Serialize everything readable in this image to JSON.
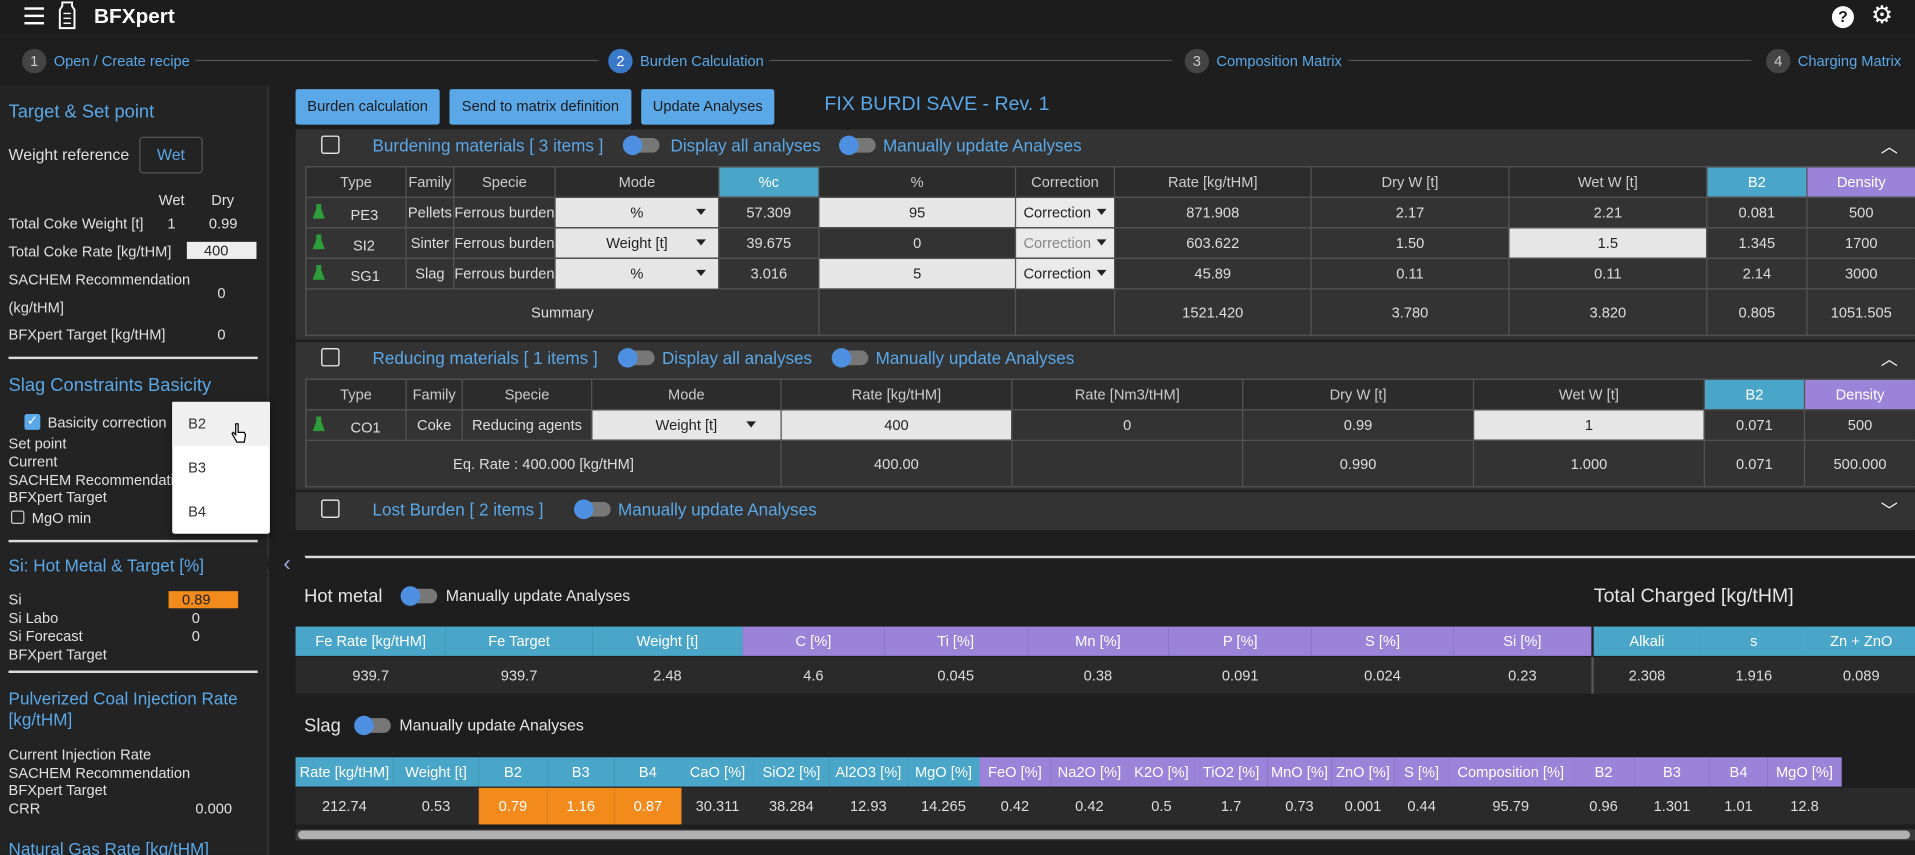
{
  "app": {
    "title": "BFXpert"
  },
  "steps": [
    {
      "num": "1",
      "label": "Open / Create recipe"
    },
    {
      "num": "2",
      "label": "Burden Calculation"
    },
    {
      "num": "3",
      "label": "Composition Matrix"
    },
    {
      "num": "4",
      "label": "Charging Matrix"
    }
  ],
  "sidebar": {
    "target_title": "Target & Set point",
    "weight_ref_label": "Weight reference",
    "weight_ref_value": "Wet",
    "col_wet": "Wet",
    "col_dry": "Dry",
    "total_coke_weight_label": "Total Coke Weight [t]",
    "total_coke_weight_wet": "1",
    "total_coke_weight_dry": "0.99",
    "total_coke_rate_label": "Total Coke Rate [kg/tHM]",
    "total_coke_rate_value": "400",
    "sachem_label_1": "SACHEM Recommendation",
    "sachem_label_2": "(kg/tHM]",
    "sachem_value": "0",
    "bfx_target_label": "BFXpert Target [kg/tHM]",
    "bfx_target_value": "0",
    "slag_title": "Slag Constraints Basicity",
    "basicity_label": "Basicity correction",
    "set_point": "Set point",
    "current": "Current",
    "sachem_rec": "SACHEM Recommendation",
    "bfx_target": "BFXpert Target",
    "mgo_min": "MgO min",
    "si_title": "Si: Hot Metal & Target [%]",
    "si_label": "Si",
    "si_value": "0.89",
    "si_labo_label": "Si Labo",
    "si_labo_value": "0",
    "si_forecast_label": "Si Forecast",
    "si_forecast_value": "0",
    "si_bfx_target": "BFXpert Target",
    "pci_title_1": "Pulverized Coal Injection Rate",
    "pci_title_2": "[kg/tHM]",
    "pci_current": "Current Injection Rate",
    "pci_sachem": "SACHEM Recommendation",
    "pci_bfx": "BFXpert Target",
    "crr_label": "CRR",
    "crr_value": "0.000",
    "ng_title": "Natural Gas Rate [kg/tHM]"
  },
  "dropdown": {
    "options": [
      "B2",
      "B3",
      "B4"
    ]
  },
  "toolbar": {
    "burden_calc": "Burden calculation",
    "send_matrix": "Send to matrix definition",
    "update_analyses": "Update Analyses",
    "recipe_name": "FIX BURDI SAVE - Rev. 1"
  },
  "burdening": {
    "title": "Burdening materials [ 3 items ]",
    "toggle1": "Display all analyses",
    "toggle2": "Manually update Analyses",
    "headers": [
      "Type",
      "Family",
      "Specie",
      "Mode",
      "%c",
      "%",
      "Correction",
      "Rate [kg/tHM]",
      "Dry W [t]",
      "Wet W [t]",
      "B2",
      "Density"
    ],
    "rows": [
      {
        "code": "PE3",
        "family": "Pellets",
        "specie": "Ferrous burden",
        "mode": "%",
        "pc": "57.309",
        "p": "95",
        "corr": "Correction",
        "rate": "871.908",
        "dry": "2.17",
        "wet": "2.21",
        "b2": "0.081",
        "density": "500"
      },
      {
        "code": "SI2",
        "family": "Sinter",
        "specie": "Ferrous burden",
        "mode": "Weight [t]",
        "pc": "39.675",
        "p": "0",
        "corr": "Correction",
        "rate": "603.622",
        "dry": "1.50",
        "wet": "1.5",
        "b2": "1.345",
        "density": "1700"
      },
      {
        "code": "SG1",
        "family": "Slag",
        "specie": "Ferrous burden",
        "mode": "%",
        "pc": "3.016",
        "p": "5",
        "corr": "Correction",
        "rate": "45.89",
        "dry": "0.11",
        "wet": "0.11",
        "b2": "2.14",
        "density": "3000"
      }
    ],
    "summary": {
      "label": "Summary",
      "rate": "1521.420",
      "dry": "3.780",
      "wet": "3.820",
      "b2": "0.805",
      "density": "1051.505"
    }
  },
  "reducing": {
    "title": "Reducing materials [ 1 items ]",
    "toggle1": "Display all analyses",
    "toggle2": "Manually update Analyses",
    "headers": [
      "Type",
      "Family",
      "Specie",
      "Mode",
      "Rate [kg/tHM]",
      "Rate [Nm3/tHM]",
      "Dry W [t]",
      "Wet W [t]",
      "B2",
      "Density"
    ],
    "row": {
      "code": "CO1",
      "family": "Coke",
      "specie": "Reducing agents",
      "mode": "Weight [t]",
      "rate": "400",
      "rate_nm3": "0",
      "dry": "0.99",
      "wet": "1",
      "b2": "0.071",
      "density": "500"
    },
    "eq": {
      "label": "Eq. Rate : 400.000 [kg/tHM]",
      "rate": "400.00",
      "dry": "0.990",
      "wet": "1.000",
      "b2": "0.071",
      "density": "500.000"
    }
  },
  "lost": {
    "title": "Lost Burden [ 2 items ]",
    "toggle": "Manually update Analyses"
  },
  "hot_metal": {
    "title": "Hot metal",
    "toggle": "Manually update Analyses",
    "total_charged": "Total Charged [kg/tHM]",
    "headers": [
      "Fe Rate [kg/tHM]",
      "Fe Target",
      "Weight [t]",
      "C [%]",
      "Ti [%]",
      "Mn [%]",
      "P [%]",
      "S [%]",
      "Si [%]",
      "Alkali",
      "s",
      "Zn + ZnO"
    ],
    "values": [
      "939.7",
      "939.7",
      "2.48",
      "4.6",
      "0.045",
      "0.38",
      "0.091",
      "0.024",
      "0.23",
      "2.308",
      "1.916",
      "0.089"
    ]
  },
  "slag": {
    "title": "Slag",
    "toggle": "Manually update Analyses",
    "headers": [
      "Rate [kg/tHM]",
      "Weight [t]",
      "B2",
      "B3",
      "B4",
      "CaO [%]",
      "SiO2 [%]",
      "Al2O3 [%]",
      "MgO [%]",
      "FeO [%]",
      "Na2O [%]",
      "K2O [%]",
      "TiO2 [%]",
      "MnO [%]",
      "ZnO [%]",
      "S [%]",
      "Composition [%]",
      "B2",
      "B3",
      "B4",
      "MgO [%]"
    ],
    "values": [
      "212.74",
      "0.53",
      "0.79",
      "1.16",
      "0.87",
      "30.311",
      "38.284",
      "12.93",
      "14.265",
      "0.42",
      "0.42",
      "0.5",
      "1.7",
      "0.73",
      "0.001",
      "0.44",
      "95.79",
      "0.96",
      "1.301",
      "1.01",
      "12.8"
    ]
  },
  "colors": {
    "accent": "#5aa8e8",
    "cyan_header": "#49a6c9",
    "purple_header": "#9a83d9",
    "orange": "#f28a1c"
  }
}
